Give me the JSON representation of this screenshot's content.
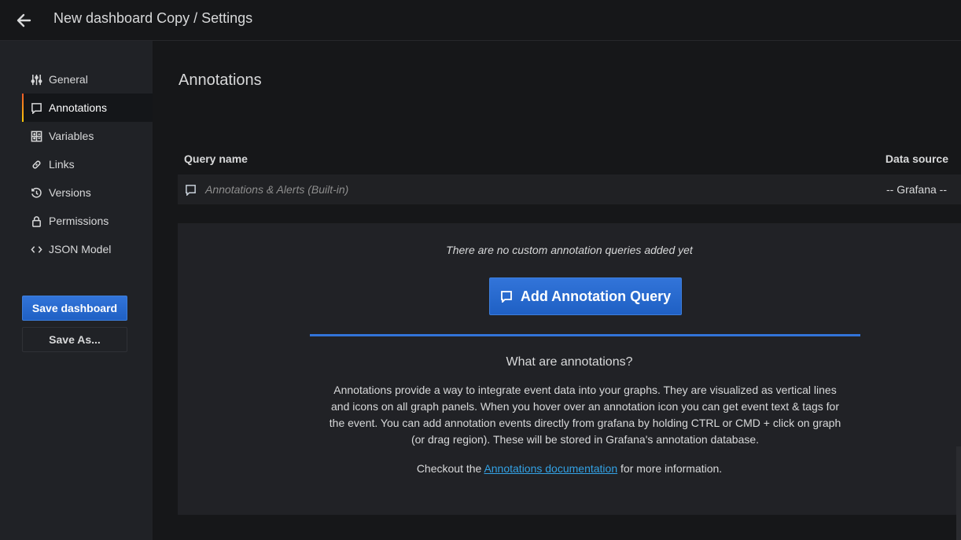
{
  "header": {
    "back_icon": "arrow-left-icon",
    "title": "New dashboard Copy / Settings"
  },
  "sidebar": {
    "items": [
      {
        "label": "General",
        "icon": "sliders-icon",
        "active": false
      },
      {
        "label": "Annotations",
        "icon": "comment-icon",
        "active": true
      },
      {
        "label": "Variables",
        "icon": "calculator-icon",
        "active": false
      },
      {
        "label": "Links",
        "icon": "link-icon",
        "active": false
      },
      {
        "label": "Versions",
        "icon": "history-icon",
        "active": false
      },
      {
        "label": "Permissions",
        "icon": "lock-icon",
        "active": false
      },
      {
        "label": "JSON Model",
        "icon": "code-icon",
        "active": false
      }
    ],
    "save_label": "Save dashboard",
    "save_as_label": "Save As..."
  },
  "main": {
    "title": "Annotations",
    "table": {
      "columns": [
        "Query name",
        "Data source"
      ],
      "rows": [
        {
          "name": "Annotations & Alerts (Built-in)",
          "datasource": "-- Grafana --"
        }
      ]
    },
    "empty_message": "There are no custom annotation queries added yet",
    "add_button_label": "Add Annotation Query",
    "help": {
      "title": "What are annotations?",
      "text": "Annotations provide a way to integrate event data into your graphs. They are visualized as vertical lines and icons on all graph panels. When you hover over an annotation icon you can get event text & tags for the event. You can add annotation events directly from grafana by holding CTRL or CMD + click on graph (or drag region). These will be stored in Grafana's annotation database.",
      "more_prefix": "Checkout the ",
      "more_link": "Annotations documentation",
      "more_suffix": " for more information."
    }
  },
  "colors": {
    "accent": "#3274d9",
    "link": "#33a2e5",
    "active_gradient_start": "#f05a28",
    "active_gradient_end": "#fbca0a"
  }
}
